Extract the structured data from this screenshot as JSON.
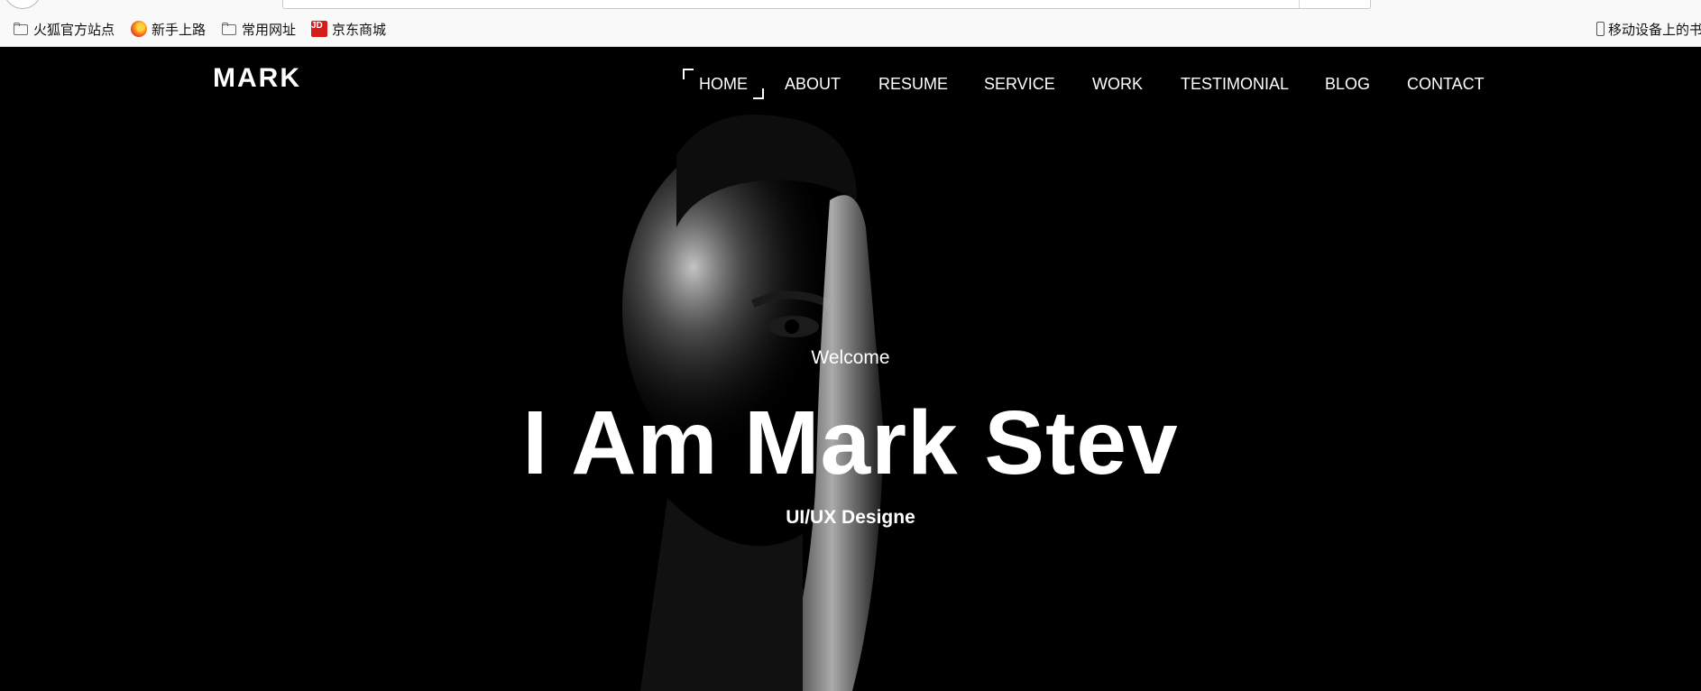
{
  "browser": {
    "bookmarks": [
      {
        "label": "火狐官方站点",
        "icon": "folder-icon"
      },
      {
        "label": "新手上路",
        "icon": "firefox-icon"
      },
      {
        "label": "常用网址",
        "icon": "folder-icon"
      },
      {
        "label": "京东商城",
        "icon": "jd-icon",
        "icon_text": "JD"
      }
    ],
    "mobile_bookmarks": {
      "label": "移动设备上的书",
      "icon": "phone-icon"
    }
  },
  "site": {
    "logo": "MARK",
    "nav": [
      {
        "label": "HOME",
        "active": true
      },
      {
        "label": "ABOUT"
      },
      {
        "label": "RESUME"
      },
      {
        "label": "SERVICE"
      },
      {
        "label": "WORK"
      },
      {
        "label": "TESTIMONIAL"
      },
      {
        "label": "BLOG"
      },
      {
        "label": "CONTACT"
      }
    ]
  },
  "hero": {
    "welcome": "Welcome",
    "headline": "I Am Mark Stev",
    "role": "UI/UX Designe"
  },
  "colors": {
    "background": "#000000",
    "text": "#ffffff",
    "chrome": "#f9f9fa"
  }
}
